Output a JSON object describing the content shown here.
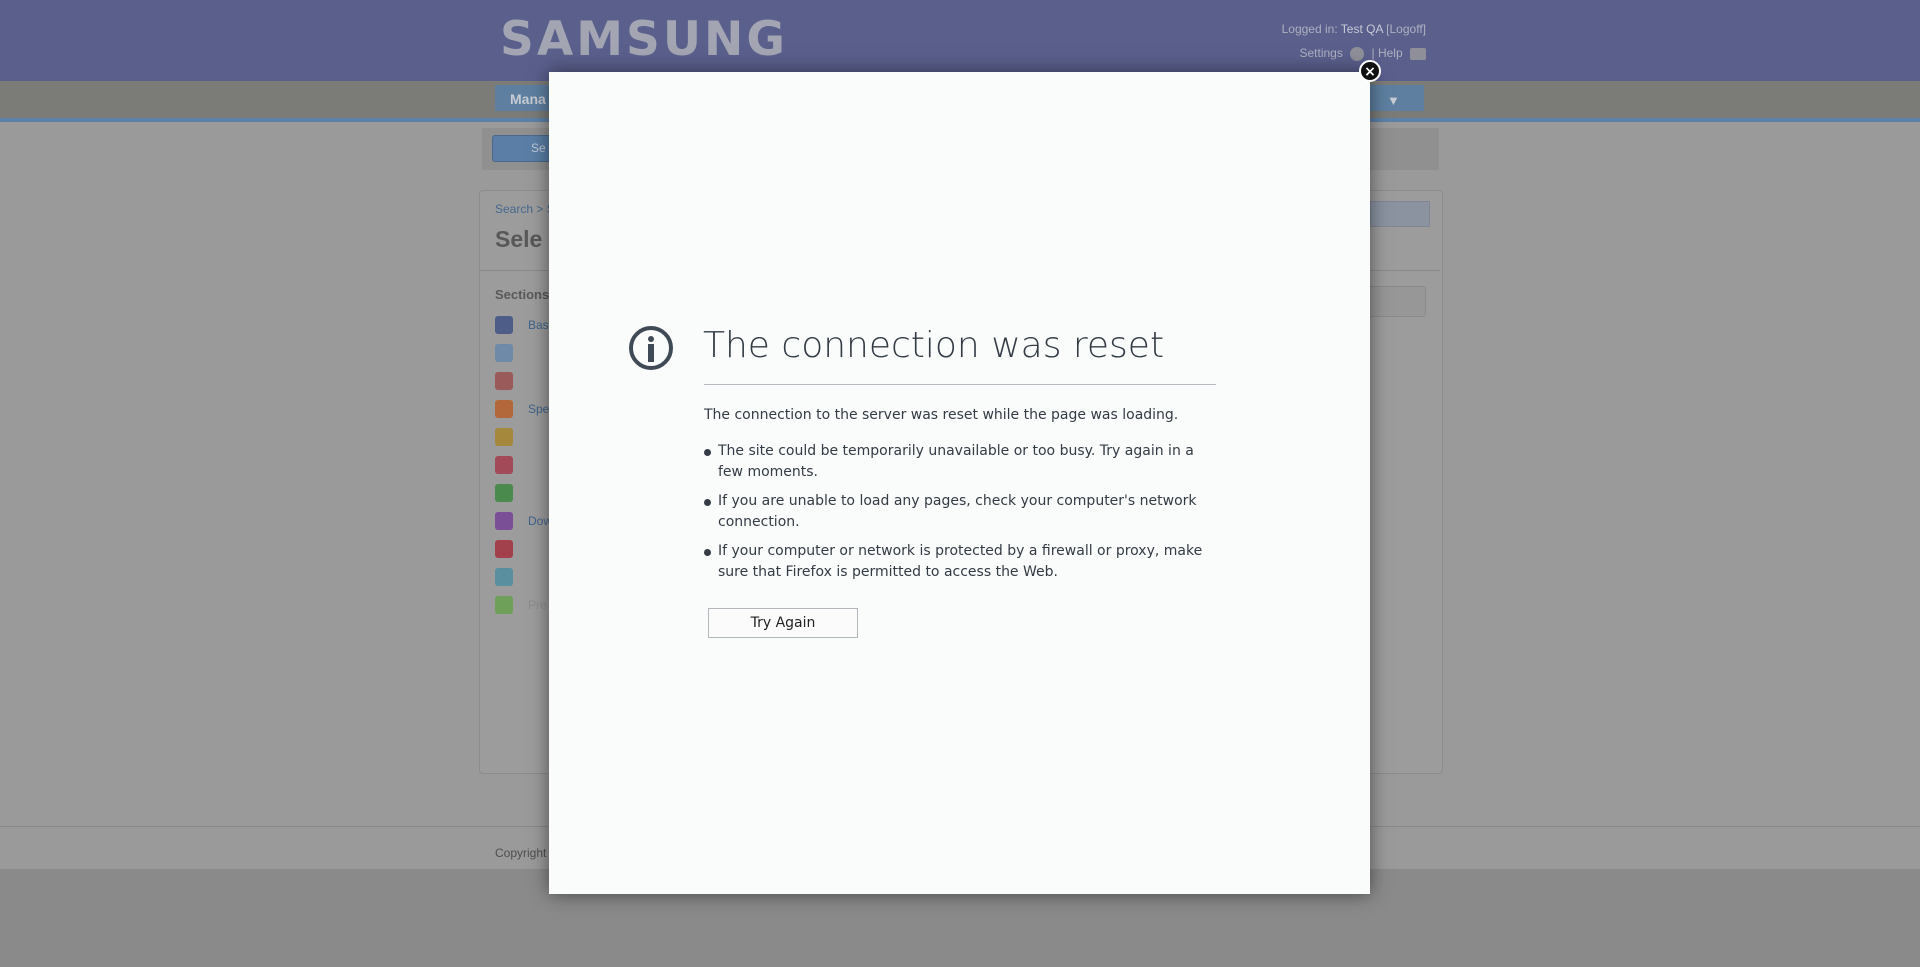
{
  "header": {
    "logo": "SAMSUNG",
    "logged_in_label": "Logged in:",
    "user": "Test QA",
    "logoff": "Logoff",
    "settings": "Settings",
    "help": "Help"
  },
  "nav": {
    "tab_partial": "Mana"
  },
  "subbar": {
    "search_partial": "Se"
  },
  "panel": {
    "breadcrumb": "Search > S",
    "title_partial": "Sele",
    "sections_label": "Sections",
    "sections": [
      {
        "label": "Bas",
        "color": "#4d5d88",
        "dim": false
      },
      {
        "label": "",
        "color": "#6f8aa8",
        "dim": true
      },
      {
        "label": "",
        "color": "#9a5a5a",
        "dim": true
      },
      {
        "label": "Spe",
        "color": "#b3683c",
        "dim": false
      },
      {
        "label": "",
        "color": "#a6883c",
        "dim": true
      },
      {
        "label": "",
        "color": "#a24a58",
        "dim": true
      },
      {
        "label": "",
        "color": "#4a8a4c",
        "dim": true
      },
      {
        "label": "Dow",
        "color": "#7a4f95",
        "dim": false
      },
      {
        "label": "",
        "color": "#a2404c",
        "dim": true
      },
      {
        "label": "",
        "color": "#5a8fa0",
        "dim": true
      },
      {
        "label": "Pre",
        "color": "#6fa05a",
        "dim": true
      }
    ]
  },
  "footer": {
    "copyright": "Copyright"
  },
  "error": {
    "title": "The connection was reset",
    "description": "The connection to the server was reset while the page was loading.",
    "bullets": [
      "The site could be temporarily unavailable or too busy. Try again in a few moments.",
      "If you are unable to load any pages, check your computer's network connection.",
      "If your computer or network is protected by a firewall or proxy, make sure that Firefox is permitted to access the Web."
    ],
    "try_again": "Try Again",
    "close_glyph": "×"
  }
}
